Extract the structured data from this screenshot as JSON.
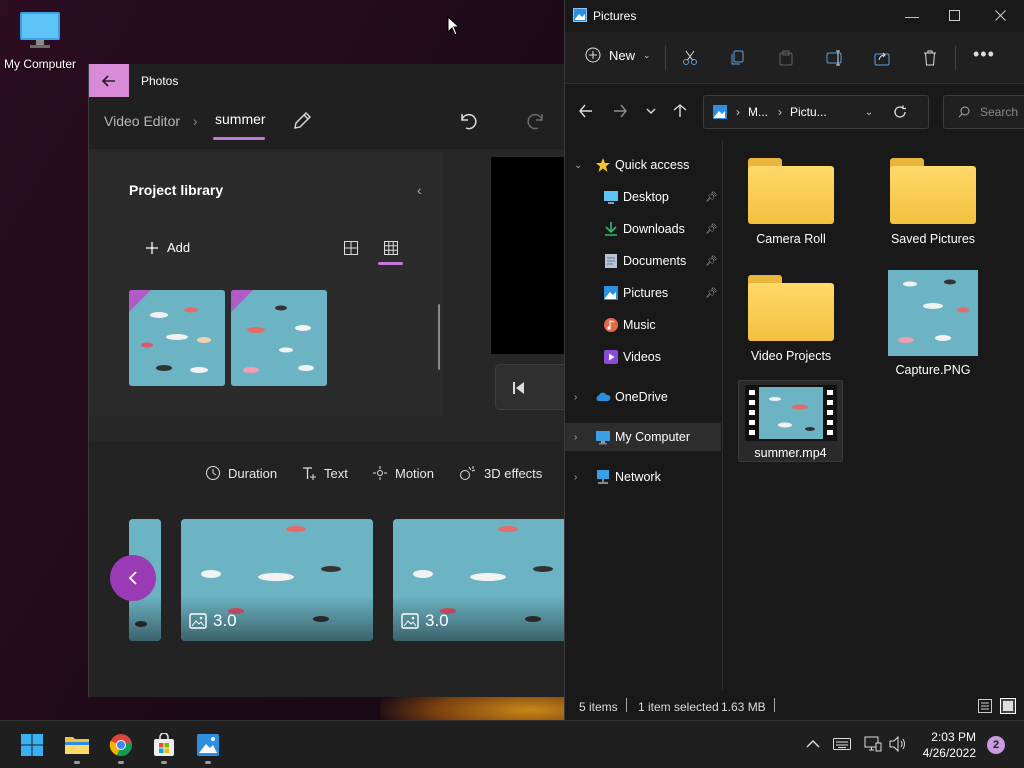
{
  "desktop": {
    "icon_label": "My Computer"
  },
  "photos": {
    "title": "Photos",
    "breadcrumb_root": "Video Editor",
    "project_name": "summer",
    "library_title": "Project library",
    "add_label": "Add",
    "tools": {
      "duration": "Duration",
      "text": "Text",
      "motion": "Motion",
      "effects": "3D effects"
    },
    "clips": [
      {
        "duration": "3.0"
      },
      {
        "duration": "3.0"
      }
    ],
    "accent": "#c57ad9"
  },
  "explorer": {
    "title": "Pictures",
    "new_label": "New",
    "address": {
      "seg1": "M...",
      "seg2": "Pictu..."
    },
    "search_placeholder": "Search",
    "nav": {
      "quick_access": "Quick access",
      "desktop": "Desktop",
      "downloads": "Downloads",
      "documents": "Documents",
      "pictures": "Pictures",
      "music": "Music",
      "videos": "Videos",
      "onedrive": "OneDrive",
      "my_computer": "My Computer",
      "network": "Network"
    },
    "files": [
      "Camera Roll",
      "Saved Pictures",
      "Video Projects",
      "Capture.PNG",
      "summer.mp4"
    ],
    "status": {
      "items": "5 items",
      "selected": "1 item selected",
      "size": "1.63 MB"
    }
  },
  "taskbar": {
    "time": "2:03 PM",
    "date": "4/26/2022",
    "notifications": "2"
  }
}
